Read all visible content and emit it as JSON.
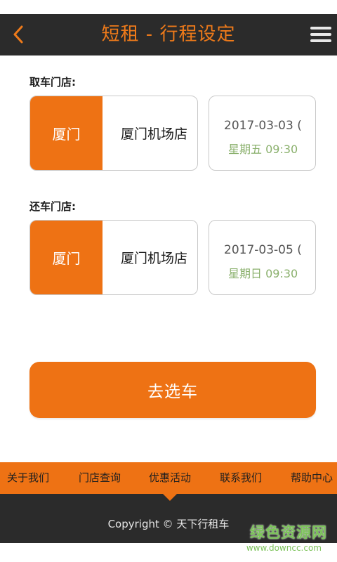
{
  "header": {
    "title": "短租 - 行程设定",
    "back_icon": "chevron-left-icon",
    "menu_icon": "hamburger-menu-icon",
    "accent_color": "#ee7a1a",
    "bar_color": "#2b2b2b"
  },
  "pickup": {
    "label": "取车门店:",
    "city": "厦门",
    "store": "厦门机场店",
    "date": "2017-03-03 (",
    "weekday_time": "星期五 09:30"
  },
  "return": {
    "label": "还车门店:",
    "city": "厦门",
    "store": "厦门机场店",
    "date": "2017-03-05 (",
    "weekday_time": "星期日 09:30"
  },
  "actions": {
    "go_select_car": "去选车",
    "primary_color": "#ee7214"
  },
  "bottom_nav": {
    "items": [
      {
        "label": "关于我们"
      },
      {
        "label": "门店查询"
      },
      {
        "label": "优惠活动"
      },
      {
        "label": "联系我们"
      },
      {
        "label": "帮助中心"
      }
    ]
  },
  "footer": {
    "copyright": "Copyright © 天下行租车"
  },
  "watermark": {
    "brand": "绿色资源网",
    "url": "www.downcc.com",
    "color": "#7cc35a"
  }
}
